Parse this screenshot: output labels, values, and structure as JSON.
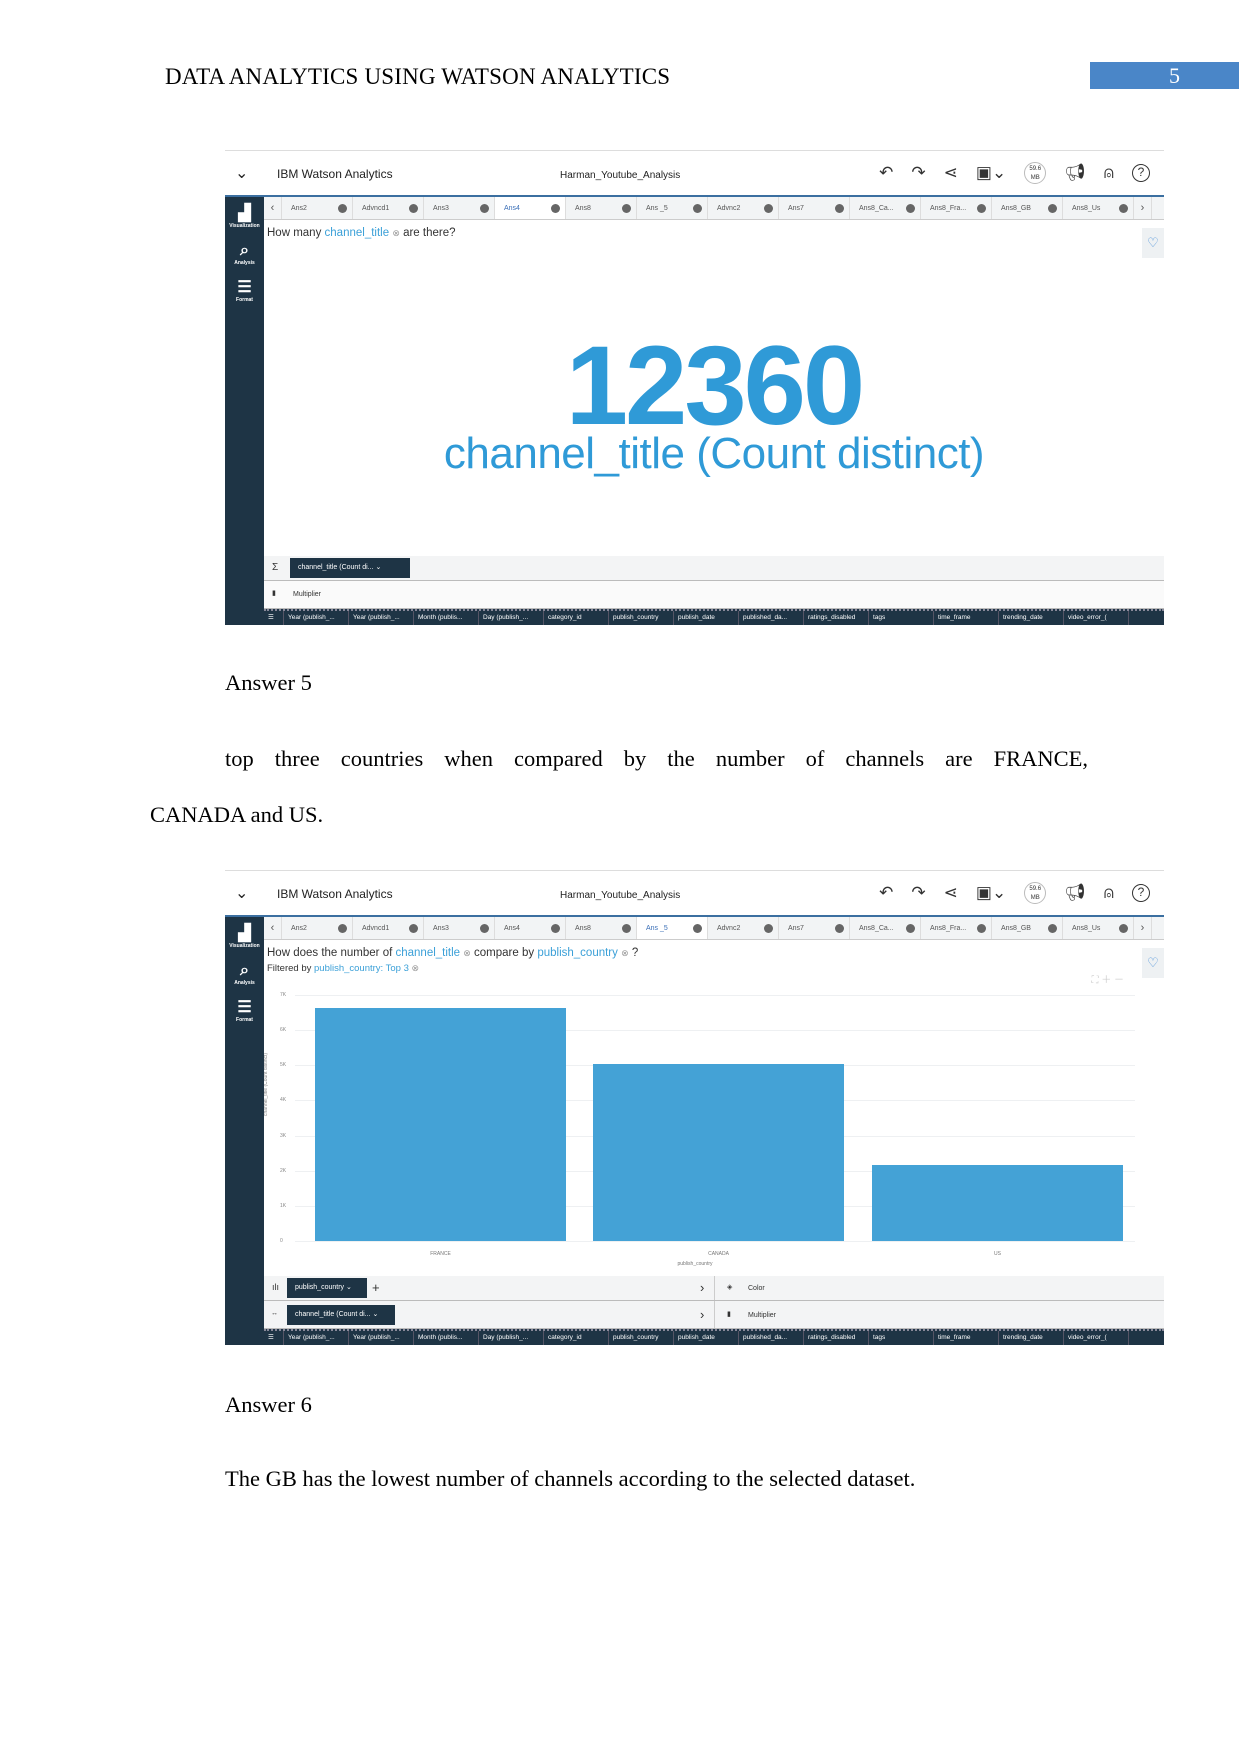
{
  "running_header": "DATA ANALYTICS USING WATSON ANALYTICS",
  "page_number": "5",
  "app": {
    "brand": "IBM Watson Analytics",
    "project": "Harman_Youtube_Analysis",
    "memory": "59.6",
    "memory_unit": "MB",
    "sidebar": [
      "Visualization",
      "Analysis",
      "Format"
    ],
    "tabs": [
      "Ans2",
      "Advncd1",
      "Ans3",
      "Ans4",
      "Ans8",
      "Ans _5",
      "Advnc2",
      "Ans7",
      "Ans8_Ca...",
      "Ans8_Fra...",
      "Ans8_GB",
      "Ans8_Us"
    ],
    "fields": [
      "Year (publish_...",
      "Year (publish_...",
      "Month (publis...",
      "Day (publish_...",
      "category_id",
      "publish_country",
      "publish_date",
      "published_da...",
      "ratings_disabled",
      "tags",
      "time_frame",
      "trending_date",
      "video_error_("
    ],
    "colors": {
      "accent": "#2f9ad7",
      "bar": "#44a2d6",
      "sidebar": "#1e3445"
    }
  },
  "shot1": {
    "active_tab": 3,
    "q_pre": "How many",
    "q_field": "channel_title",
    "q_post": "are there?",
    "value": "12360",
    "value_label": "channel_title (Count distinct)",
    "pill": "channel_title (Count di...",
    "multiplier": "Multiplier",
    "sigma": "Σ"
  },
  "answer5": {
    "heading": "Answer 5",
    "line1": "top three countries when compared by the number of channels are FRANCE,",
    "line2": "CANADA and US."
  },
  "shot2": {
    "active_tab": 5,
    "q_pre": "How does the number of",
    "q_field": "channel_title",
    "q_mid": "compare by",
    "q_field2": "publish_country",
    "q_post": "?",
    "filter_pre": "Filtered by",
    "filter": "publish_country: Top 3",
    "pill1": "publish_country",
    "pill2": "channel_title (Count di...",
    "color": "Color",
    "multiplier": "Multiplier"
  },
  "chart_data": {
    "type": "bar",
    "categories": [
      "FRANCE",
      "CANADA",
      "US"
    ],
    "values": [
      6620,
      5030,
      2160
    ],
    "xlabel": "publish_country",
    "ylabel": "channel_title (Count distinct)",
    "ylim": [
      0,
      7000
    ],
    "yticks": [
      "0",
      "1K",
      "2K",
      "3K",
      "4K",
      "5K",
      "6K",
      "7K"
    ],
    "grid": true
  },
  "answer6": {
    "heading": "Answer 6",
    "text": "The GB has the lowest number of channels according to the selected dataset."
  }
}
